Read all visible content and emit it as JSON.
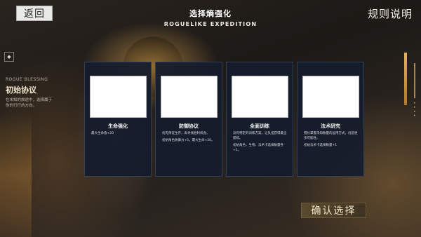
{
  "header": {
    "back_label": "返回",
    "title": "选择熵强化",
    "subtitle": "ROGUELIKE EXPEDITION",
    "rules_label": "规则说明"
  },
  "sidebar": {
    "tag_glyph": "◆",
    "blessing_en": "ROGUE BLESSING",
    "blessing_title": "初始协议",
    "blessing_desc": "在未知的旅途中，选择属于你的行行的方向。"
  },
  "cards": [
    {
      "name": "生命强化",
      "desc_lines": [
        "最大生命值+20"
      ]
    },
    {
      "name": "防御协议",
      "desc_lines": [
        "优先保证生存，再寻找胜利机会。",
        "初始角色防御力+5。最大生命+20。"
      ]
    },
    {
      "name": "全面训练",
      "desc_lines": [
        "没有特定的训练方案，让队伍获得最全提练。",
        "初始角色，生物、法术卡选择数量各+1。"
      ]
    },
    {
      "name": "法术研究",
      "desc_lines": [
        "擅长掌握未知数量的运用方式，创造更多可能性。",
        "初始法术卡选择数量+1"
      ]
    }
  ],
  "footer": {
    "confirm_label": "确认选择"
  },
  "colors": {
    "accent_gold": "#e6b15a",
    "card_bg": "#141c2c"
  }
}
